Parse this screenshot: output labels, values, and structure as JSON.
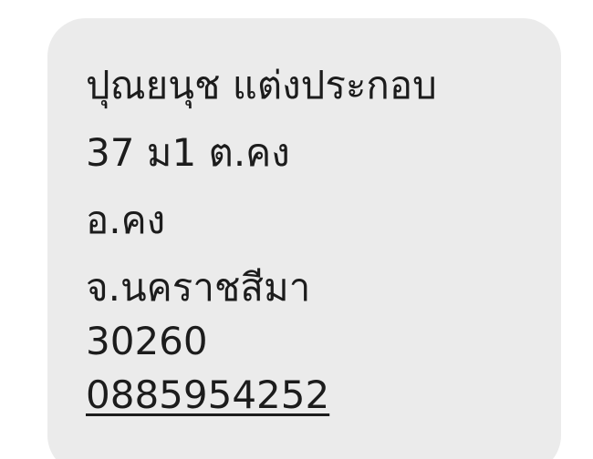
{
  "message": {
    "lines": [
      "ปุณยนุช แต่งประกอบ",
      "37 ม1 ต.คง",
      "อ.คง",
      "จ.นคราชสีมา",
      "30260"
    ],
    "phone": "0885954252"
  },
  "colors": {
    "bubble": "#ebebeb",
    "text": "#1c1c1c",
    "background": "#ffffff"
  }
}
